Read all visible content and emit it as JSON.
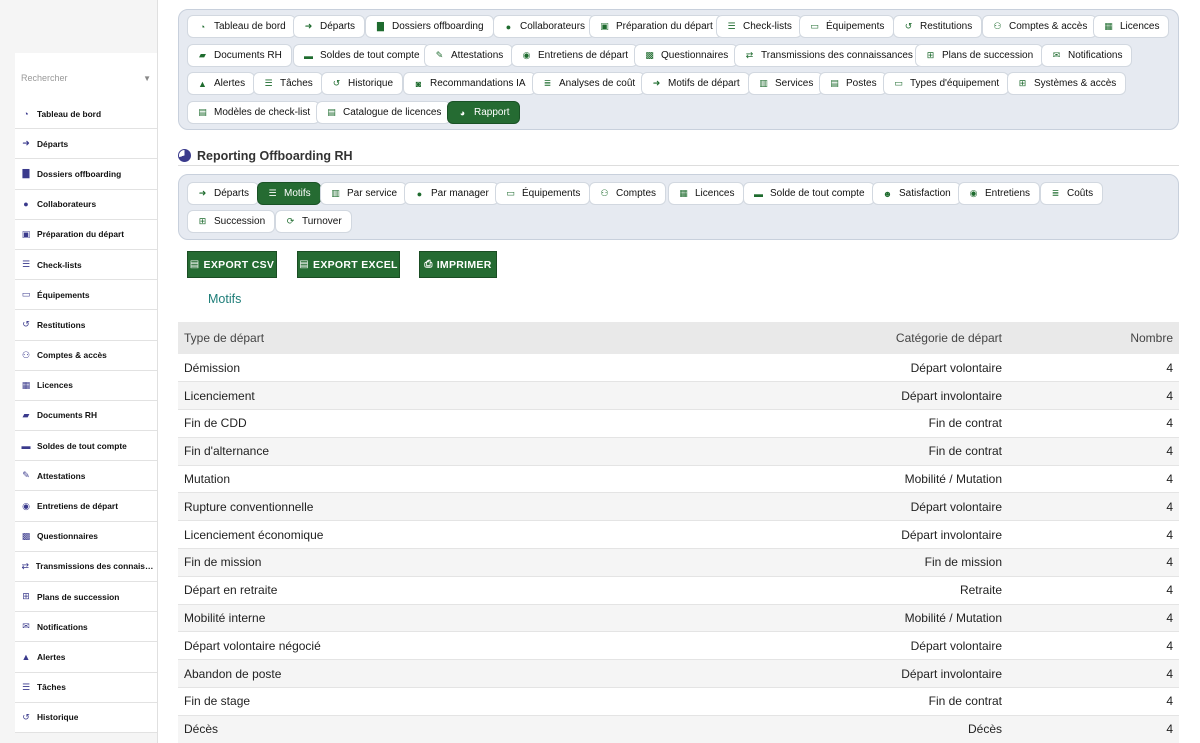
{
  "sidebar": {
    "search_placeholder": "Rechercher",
    "items": [
      {
        "label": "Tableau de bord",
        "icon": "dashboard-icon"
      },
      {
        "label": "Départs",
        "icon": "sign-out-icon"
      },
      {
        "label": "Dossiers offboarding",
        "icon": "folder-user-icon"
      },
      {
        "label": "Collaborateurs",
        "icon": "user-icon"
      },
      {
        "label": "Préparation du départ",
        "icon": "clipboard-check-icon"
      },
      {
        "label": "Check-lists",
        "icon": "list-icon"
      },
      {
        "label": "Équipements",
        "icon": "laptop-icon"
      },
      {
        "label": "Restitutions",
        "icon": "undo-icon"
      },
      {
        "label": "Comptes & accès",
        "icon": "users-cog-icon"
      },
      {
        "label": "Licences",
        "icon": "id-badge-icon"
      },
      {
        "label": "Documents RH",
        "icon": "folder-open-icon"
      },
      {
        "label": "Soldes de tout compte",
        "icon": "money-bill-icon"
      },
      {
        "label": "Attestations",
        "icon": "file-signature-icon"
      },
      {
        "label": "Entretiens de départ",
        "icon": "comments-icon"
      },
      {
        "label": "Questionnaires",
        "icon": "poll-icon"
      },
      {
        "label": "Transmissions des connaissances",
        "icon": "exchange-icon"
      },
      {
        "label": "Plans de succession",
        "icon": "sitemap-icon"
      },
      {
        "label": "Notifications",
        "icon": "envelope-icon"
      },
      {
        "label": "Alertes",
        "icon": "bell-icon"
      },
      {
        "label": "Tâches",
        "icon": "tasks-icon"
      },
      {
        "label": "Historique",
        "icon": "history-icon"
      }
    ]
  },
  "topnav": {
    "items": [
      {
        "label": "Tableau de bord",
        "icon": "dashboard-icon"
      },
      {
        "label": "Départs",
        "icon": "sign-out-icon"
      },
      {
        "label": "Dossiers offboarding",
        "icon": "folder-user-icon"
      },
      {
        "label": "Collaborateurs",
        "icon": "user-icon"
      },
      {
        "label": "Préparation du départ",
        "icon": "clipboard-check-icon"
      },
      {
        "label": "Check-lists",
        "icon": "list-icon"
      },
      {
        "label": "Équipements",
        "icon": "laptop-icon"
      },
      {
        "label": "Restitutions",
        "icon": "undo-icon"
      },
      {
        "label": "Comptes & accès",
        "icon": "users-cog-icon"
      },
      {
        "label": "Licences",
        "icon": "id-badge-icon"
      },
      {
        "label": "Documents RH",
        "icon": "folder-open-icon"
      },
      {
        "label": "Soldes de tout compte",
        "icon": "money-bill-icon"
      },
      {
        "label": "Attestations",
        "icon": "file-signature-icon"
      },
      {
        "label": "Entretiens de départ",
        "icon": "comments-icon"
      },
      {
        "label": "Questionnaires",
        "icon": "poll-icon"
      },
      {
        "label": "Transmissions des connaissances",
        "icon": "exchange-icon"
      },
      {
        "label": "Plans de succession",
        "icon": "sitemap-icon"
      },
      {
        "label": "Notifications",
        "icon": "envelope-icon"
      },
      {
        "label": "Alertes",
        "icon": "bell-icon"
      },
      {
        "label": "Tâches",
        "icon": "tasks-icon"
      },
      {
        "label": "Historique",
        "icon": "history-icon"
      },
      {
        "label": "Recommandations IA",
        "icon": "robot-icon"
      },
      {
        "label": "Analyses de coût",
        "icon": "money-stack-icon"
      },
      {
        "label": "Motifs de départ",
        "icon": "sign-out-icon"
      },
      {
        "label": "Services",
        "icon": "building-icon"
      },
      {
        "label": "Postes",
        "icon": "id-card-icon"
      },
      {
        "label": "Types d'équipement",
        "icon": "laptop-icon"
      },
      {
        "label": "Systèmes & accès",
        "icon": "network-icon"
      },
      {
        "label": "Modèles de check-list",
        "icon": "list-alt-icon"
      },
      {
        "label": "Catalogue de licences",
        "icon": "id-card-icon"
      },
      {
        "label": "Rapport",
        "icon": "chart-pie-icon",
        "active": true
      }
    ]
  },
  "section": {
    "title": "Reporting Offboarding RH",
    "icon": "chart-pie-icon"
  },
  "subtabs": {
    "items": [
      {
        "label": "Départs",
        "icon": "sign-out-icon"
      },
      {
        "label": "Motifs",
        "icon": "list-icon",
        "active": true
      },
      {
        "label": "Par service",
        "icon": "building-icon"
      },
      {
        "label": "Par manager",
        "icon": "user-tie-icon"
      },
      {
        "label": "Équipements",
        "icon": "laptop-icon"
      },
      {
        "label": "Comptes",
        "icon": "users-cog-icon"
      },
      {
        "label": "Licences",
        "icon": "id-badge-icon"
      },
      {
        "label": "Solde de tout compte",
        "icon": "money-bill-icon"
      },
      {
        "label": "Satisfaction",
        "icon": "smile-icon"
      },
      {
        "label": "Entretiens",
        "icon": "comments-icon"
      },
      {
        "label": "Coûts",
        "icon": "money-stack-icon"
      },
      {
        "label": "Succession",
        "icon": "sitemap-icon"
      },
      {
        "label": "Turnover",
        "icon": "sync-icon"
      }
    ]
  },
  "actions": {
    "export_csv": "EXPORT CSV",
    "export_excel": "EXPORT EXCEL",
    "print": "IMPRIMER"
  },
  "report": {
    "title": "Motifs",
    "columns": [
      "Type de départ",
      "Catégorie de départ",
      "Nombre"
    ],
    "rows": [
      [
        "Démission",
        "Départ volontaire",
        "4"
      ],
      [
        "Licenciement",
        "Départ involontaire",
        "4"
      ],
      [
        "Fin de CDD",
        "Fin de contrat",
        "4"
      ],
      [
        "Fin d'alternance",
        "Fin de contrat",
        "4"
      ],
      [
        "Mutation",
        "Mobilité / Mutation",
        "4"
      ],
      [
        "Rupture conventionnelle",
        "Départ volontaire",
        "4"
      ],
      [
        "Licenciement économique",
        "Départ involontaire",
        "4"
      ],
      [
        "Fin de mission",
        "Fin de mission",
        "4"
      ],
      [
        "Départ en retraite",
        "Retraite",
        "4"
      ],
      [
        "Mobilité interne",
        "Mobilité / Mutation",
        "4"
      ],
      [
        "Départ volontaire négocié",
        "Départ volontaire",
        "4"
      ],
      [
        "Abandon de poste",
        "Départ involontaire",
        "4"
      ],
      [
        "Fin de stage",
        "Fin de contrat",
        "4"
      ],
      [
        "Décès",
        "Décès",
        "4"
      ]
    ]
  },
  "colors": {
    "accent": "#256b32",
    "title_teal": "#1d7d78",
    "panel_bg": "#e6eaf1"
  }
}
